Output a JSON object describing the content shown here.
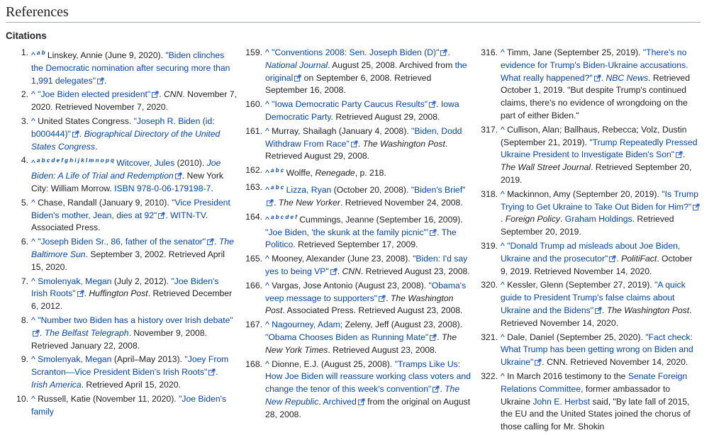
{
  "page": {
    "heading": "References",
    "subheading": "Citations"
  },
  "columns": [
    [
      {
        "num": "1.",
        "parts": [
          {
            "t": "caret",
            "v": "^"
          },
          {
            "t": "sup",
            "v": " a b"
          },
          {
            "t": "text",
            "v": " Linskey, Annie (June 9, 2020). "
          },
          {
            "t": "link",
            "v": "\"Biden clinches the Democratic nomination after securing more than 1,991 delegates\""
          },
          {
            "t": "ext"
          },
          {
            "t": "text",
            "v": "."
          }
        ]
      },
      {
        "num": "2.",
        "parts": [
          {
            "t": "caret",
            "v": "^"
          },
          {
            "t": "text",
            "v": " "
          },
          {
            "t": "link",
            "v": "\"Joe Biden elected president\""
          },
          {
            "t": "ext"
          },
          {
            "t": "text",
            "v": ". "
          },
          {
            "t": "ital",
            "v": "CNN"
          },
          {
            "t": "text",
            "v": ". November 7, 2020. Retrieved November 7, 2020."
          }
        ]
      },
      {
        "num": "3.",
        "parts": [
          {
            "t": "caret",
            "v": "^"
          },
          {
            "t": "text",
            "v": " United States Congress. "
          },
          {
            "t": "link",
            "v": "\"Joseph R. Biden (id: b000444)\""
          },
          {
            "t": "ext"
          },
          {
            "t": "text",
            "v": ". "
          },
          {
            "t": "ilink",
            "v": "Biographical Directory of the United States Congress"
          },
          {
            "t": "text",
            "v": "."
          }
        ]
      },
      {
        "num": "4.",
        "parts": [
          {
            "t": "caret",
            "v": "^"
          },
          {
            "t": "sup",
            "v": " a b c d e f g h i j k l m n o p q"
          },
          {
            "t": "text",
            "v": " "
          },
          {
            "t": "link",
            "v": "Witcover, Jules"
          },
          {
            "t": "text",
            "v": " (2010). "
          },
          {
            "t": "ilink",
            "v": "Joe Biden: A Life of Trial and Redemption"
          },
          {
            "t": "ext"
          },
          {
            "t": "text",
            "v": ". New York City: William Morrow. "
          },
          {
            "t": "link",
            "v": "ISBN 978-0-06-179198-7"
          },
          {
            "t": "text",
            "v": "."
          }
        ]
      },
      {
        "num": "5.",
        "parts": [
          {
            "t": "caret",
            "v": "^"
          },
          {
            "t": "text",
            "v": " Chase, Randall (January 9, 2010). "
          },
          {
            "t": "link",
            "v": "\"Vice President Biden's mother, Jean, dies at 92\""
          },
          {
            "t": "ext"
          },
          {
            "t": "text",
            "v": ". "
          },
          {
            "t": "link",
            "v": "WITN-TV"
          },
          {
            "t": "text",
            "v": ". Associated Press."
          }
        ]
      },
      {
        "num": "6.",
        "parts": [
          {
            "t": "caret",
            "v": "^"
          },
          {
            "t": "text",
            "v": " "
          },
          {
            "t": "link",
            "v": "\"Joseph Biden Sr., 86, father of the senator\""
          },
          {
            "t": "ext"
          },
          {
            "t": "text",
            "v": ". "
          },
          {
            "t": "ilink",
            "v": "The Baltimore Sun"
          },
          {
            "t": "text",
            "v": ". September 3, 2002. Retrieved April 15, 2020."
          }
        ]
      },
      {
        "num": "7.",
        "parts": [
          {
            "t": "caret",
            "v": "^"
          },
          {
            "t": "text",
            "v": " "
          },
          {
            "t": "link",
            "v": "Smolenyak, Megan"
          },
          {
            "t": "text",
            "v": " (July 2, 2012). "
          },
          {
            "t": "link",
            "v": "\"Joe Biden's Irish Roots\""
          },
          {
            "t": "ext"
          },
          {
            "t": "text",
            "v": ". "
          },
          {
            "t": "ital",
            "v": "Huffington Post"
          },
          {
            "t": "text",
            "v": ". Retrieved December 6, 2012."
          }
        ]
      },
      {
        "num": "8.",
        "parts": [
          {
            "t": "caret",
            "v": "^"
          },
          {
            "t": "text",
            "v": " "
          },
          {
            "t": "link",
            "v": "\"Number two Biden has a history over Irish debate\""
          },
          {
            "t": "ext"
          },
          {
            "t": "text",
            "v": ". "
          },
          {
            "t": "ilink",
            "v": "The Belfast Telegraph"
          },
          {
            "t": "text",
            "v": ". November 9, 2008. Retrieved January 22, 2008."
          }
        ]
      },
      {
        "num": "9.",
        "parts": [
          {
            "t": "caret",
            "v": "^"
          },
          {
            "t": "text",
            "v": " "
          },
          {
            "t": "link",
            "v": "Smolenyak, Megan"
          },
          {
            "t": "text",
            "v": " (April–May 2013). "
          },
          {
            "t": "link",
            "v": "\"Joey From Scranton—Vice President Biden's Irish Roots\""
          },
          {
            "t": "ext"
          },
          {
            "t": "text",
            "v": ". "
          },
          {
            "t": "ilink",
            "v": "Irish America"
          },
          {
            "t": "text",
            "v": ". Retrieved April 15, 2020."
          }
        ]
      },
      {
        "num": "10.",
        "parts": [
          {
            "t": "caret",
            "v": "^"
          },
          {
            "t": "text",
            "v": " Russell, Katie (November 11, 2020). "
          },
          {
            "t": "link",
            "v": "\"Joe Biden's family"
          }
        ]
      }
    ],
    [
      {
        "num": "159.",
        "parts": [
          {
            "t": "caret",
            "v": "^"
          },
          {
            "t": "text",
            "v": " "
          },
          {
            "t": "link",
            "v": "\"Conventions 2008: Sen. Joseph Biden (D)\""
          },
          {
            "t": "ext"
          },
          {
            "t": "text",
            "v": ". "
          },
          {
            "t": "ilink",
            "v": "National Journal"
          },
          {
            "t": "text",
            "v": ". August 25, 2008. Archived from "
          },
          {
            "t": "link",
            "v": "the original"
          },
          {
            "t": "ext"
          },
          {
            "t": "text",
            "v": " on September 6, 2008. Retrieved September 16, 2008."
          }
        ]
      },
      {
        "num": "160.",
        "parts": [
          {
            "t": "caret",
            "v": "^"
          },
          {
            "t": "text",
            "v": " "
          },
          {
            "t": "link",
            "v": "\"Iowa Democratic Party Caucus Results\""
          },
          {
            "t": "ext"
          },
          {
            "t": "text",
            "v": ". "
          },
          {
            "t": "link",
            "v": "Iowa Democratic Party"
          },
          {
            "t": "text",
            "v": ". Retrieved August 29, 2008."
          }
        ]
      },
      {
        "num": "161.",
        "parts": [
          {
            "t": "caret",
            "v": "^"
          },
          {
            "t": "text",
            "v": " Murray, Shailagh (January 4, 2008). "
          },
          {
            "t": "link",
            "v": "\"Biden, Dodd Withdraw From Race\""
          },
          {
            "t": "ext"
          },
          {
            "t": "text",
            "v": ". "
          },
          {
            "t": "ital",
            "v": "The Washington Post"
          },
          {
            "t": "text",
            "v": ". Retrieved August 29, 2008."
          }
        ]
      },
      {
        "num": "162.",
        "parts": [
          {
            "t": "caret",
            "v": "^"
          },
          {
            "t": "sup",
            "v": " a b c"
          },
          {
            "t": "text",
            "v": " Wolffe, "
          },
          {
            "t": "ital",
            "v": "Renegade"
          },
          {
            "t": "text",
            "v": ", p. 218."
          }
        ]
      },
      {
        "num": "163.",
        "parts": [
          {
            "t": "caret",
            "v": "^"
          },
          {
            "t": "sup",
            "v": " a b c"
          },
          {
            "t": "text",
            "v": " "
          },
          {
            "t": "link",
            "v": "Lizza, Ryan"
          },
          {
            "t": "text",
            "v": " (October 20, 2008). "
          },
          {
            "t": "link",
            "v": "\"Biden's Brief\""
          },
          {
            "t": "ext"
          },
          {
            "t": "text",
            "v": ". "
          },
          {
            "t": "ital",
            "v": "The New Yorker"
          },
          {
            "t": "text",
            "v": ". Retrieved November 24, 2008."
          }
        ]
      },
      {
        "num": "164.",
        "parts": [
          {
            "t": "caret",
            "v": "^"
          },
          {
            "t": "sup",
            "v": " a b c d e f"
          },
          {
            "t": "text",
            "v": " Cummings, Jeanne (September 16, 2009). "
          },
          {
            "t": "link",
            "v": "\"Joe Biden, 'the skunk at the family picnic'\""
          },
          {
            "t": "ext"
          },
          {
            "t": "text",
            "v": ". "
          },
          {
            "t": "link",
            "v": "The Politico"
          },
          {
            "t": "text",
            "v": ". Retrieved September 17, 2009."
          }
        ]
      },
      {
        "num": "165.",
        "parts": [
          {
            "t": "caret",
            "v": "^"
          },
          {
            "t": "text",
            "v": " Mooney, Alexander (June 23, 2008). "
          },
          {
            "t": "link",
            "v": "\"Biden: I'd say yes to being VP\""
          },
          {
            "t": "ext"
          },
          {
            "t": "text",
            "v": ". "
          },
          {
            "t": "ital",
            "v": "CNN"
          },
          {
            "t": "text",
            "v": ". Retrieved August 23, 2008."
          }
        ]
      },
      {
        "num": "166.",
        "parts": [
          {
            "t": "caret",
            "v": "^"
          },
          {
            "t": "text",
            "v": " Vargas, Jose Antonio (August 23, 2008). "
          },
          {
            "t": "link",
            "v": "\"Obama's veep message to supporters\""
          },
          {
            "t": "ext"
          },
          {
            "t": "text",
            "v": ". "
          },
          {
            "t": "ital",
            "v": "The Washington Post"
          },
          {
            "t": "text",
            "v": ". Associated Press. Retrieved August 23, 2008."
          }
        ]
      },
      {
        "num": "167.",
        "parts": [
          {
            "t": "caret",
            "v": "^"
          },
          {
            "t": "text",
            "v": " "
          },
          {
            "t": "link",
            "v": "Nagourney, Adam"
          },
          {
            "t": "text",
            "v": "; Zeleny, Jeff (August 23, 2008). "
          },
          {
            "t": "link",
            "v": "\"Obama Chooses Biden as Running Mate\""
          },
          {
            "t": "ext"
          },
          {
            "t": "text",
            "v": ". "
          },
          {
            "t": "ital",
            "v": "The New York Times"
          },
          {
            "t": "text",
            "v": ". Retrieved August 23, 2008."
          }
        ]
      },
      {
        "num": "168.",
        "parts": [
          {
            "t": "caret",
            "v": "^"
          },
          {
            "t": "text",
            "v": " Dionne, E.J. (August 25, 2008). "
          },
          {
            "t": "link",
            "v": "\"Tramps Like Us: How Joe Biden will reassure working class voters and change the tenor of this week's convention\""
          },
          {
            "t": "ext"
          },
          {
            "t": "text",
            "v": ". "
          },
          {
            "t": "ilink",
            "v": "The New Republic"
          },
          {
            "t": "text",
            "v": ". "
          },
          {
            "t": "link",
            "v": "Archived"
          },
          {
            "t": "ext"
          },
          {
            "t": "text",
            "v": " from the original on August 28, 2008."
          }
        ]
      }
    ],
    [
      {
        "num": "316.",
        "parts": [
          {
            "t": "caret",
            "v": "^"
          },
          {
            "t": "text",
            "v": " Timm, Jane (September 25, 2019). "
          },
          {
            "t": "link",
            "v": "\"There's no evidence for Trump's Biden-Ukraine accusations. What really happened?\""
          },
          {
            "t": "ext"
          },
          {
            "t": "text",
            "v": ". "
          },
          {
            "t": "ilink",
            "v": "NBC News"
          },
          {
            "t": "text",
            "v": ". Retrieved October 1, 2019. \"But despite Trump's continued claims, there's no evidence of wrongdoing on the part of either Biden.\""
          }
        ]
      },
      {
        "num": "317.",
        "parts": [
          {
            "t": "caret",
            "v": "^"
          },
          {
            "t": "text",
            "v": " Cullison, Alan; Ballhaus, Rebecca; Volz, Dustin (September 21, 2019). "
          },
          {
            "t": "link",
            "v": "\"Trump Repeatedly Pressed Ukraine President to Investigate Biden's Son\""
          },
          {
            "t": "ext"
          },
          {
            "t": "text",
            "v": ". "
          },
          {
            "t": "ital",
            "v": "The Wall Street Journal"
          },
          {
            "t": "text",
            "v": ". Retrieved September 20, 2019."
          }
        ]
      },
      {
        "num": "318.",
        "parts": [
          {
            "t": "caret",
            "v": "^"
          },
          {
            "t": "text",
            "v": " Mackinnon, Amy (September 20, 2019). "
          },
          {
            "t": "link",
            "v": "\"Is Trump Trying to Get Ukraine to Take Out Biden for Him?\""
          },
          {
            "t": "ext"
          },
          {
            "t": "text",
            "v": ". "
          },
          {
            "t": "ital",
            "v": "Foreign Policy"
          },
          {
            "t": "text",
            "v": ". "
          },
          {
            "t": "link",
            "v": "Graham Holdings"
          },
          {
            "t": "text",
            "v": ". Retrieved September 20, 2019."
          }
        ]
      },
      {
        "num": "319.",
        "parts": [
          {
            "t": "caret",
            "v": "^"
          },
          {
            "t": "text",
            "v": " "
          },
          {
            "t": "link",
            "v": "\"Donald Trump ad misleads about Joe Biden, Ukraine and the prosecutor\""
          },
          {
            "t": "ext"
          },
          {
            "t": "text",
            "v": ". "
          },
          {
            "t": "ital",
            "v": "PolitiFact"
          },
          {
            "t": "text",
            "v": ". October 9, 2019. Retrieved November 14, 2020."
          }
        ]
      },
      {
        "num": "320.",
        "parts": [
          {
            "t": "caret",
            "v": "^"
          },
          {
            "t": "text",
            "v": " Kessler, Glenn (September 27, 2019). "
          },
          {
            "t": "link",
            "v": "\"A quick guide to President Trump's false claims about Ukraine and the Bidens\""
          },
          {
            "t": "ext"
          },
          {
            "t": "text",
            "v": ". "
          },
          {
            "t": "ital",
            "v": "The Washington Post"
          },
          {
            "t": "text",
            "v": ". Retrieved November 14, 2020."
          }
        ]
      },
      {
        "num": "321.",
        "parts": [
          {
            "t": "caret",
            "v": "^"
          },
          {
            "t": "text",
            "v": " Dale, Daniel (September 25, 2020). "
          },
          {
            "t": "link",
            "v": "\"Fact check: What Trump has been getting wrong on Biden and Ukraine\""
          },
          {
            "t": "ext"
          },
          {
            "t": "text",
            "v": ". CNN. Retrieved November 14, 2020."
          }
        ]
      },
      {
        "num": "322.",
        "parts": [
          {
            "t": "caret",
            "v": "^"
          },
          {
            "t": "text",
            "v": " In March 2016 testimony to the "
          },
          {
            "t": "link",
            "v": "Senate Foreign Relations Committee"
          },
          {
            "t": "text",
            "v": ", former ambassador to Ukraine "
          },
          {
            "t": "link",
            "v": "John E. Herbst"
          },
          {
            "t": "text",
            "v": " said, \"By late fall of 2015, the EU and the United States joined the chorus of those calling for Mr. Shokin"
          }
        ]
      }
    ]
  ]
}
